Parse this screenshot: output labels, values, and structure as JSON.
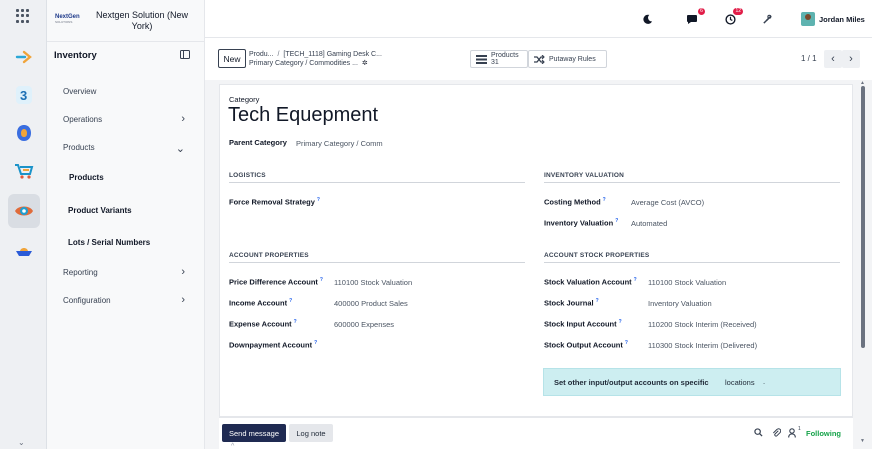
{
  "company": {
    "logo_text": "NextGen",
    "logo_sub": "SOLUTIONS",
    "name": "Nextgen Solution (New York)"
  },
  "apps": [
    {
      "icon": "discuss-app-icon"
    },
    {
      "icon": "3cx-app-icon"
    },
    {
      "icon": "apps-icon"
    },
    {
      "icon": "sales-cart-icon"
    },
    {
      "icon": "inventory-app-icon"
    },
    {
      "icon": "boat-app-icon"
    }
  ],
  "sidebar": {
    "module_title": "Inventory",
    "items": [
      {
        "label": "Overview"
      },
      {
        "label": "Operations"
      },
      {
        "label": "Products"
      },
      {
        "label": "Reporting"
      },
      {
        "label": "Configuration"
      }
    ],
    "sub_items": [
      {
        "label": "Products"
      },
      {
        "label": "Product Variants"
      },
      {
        "label": "Lots / Serial Numbers"
      }
    ]
  },
  "topbar": {
    "messages_badge": "6",
    "activities_badge": "12",
    "user_name": "Jordan Miles"
  },
  "control": {
    "new_label": "New",
    "breadcrumb_1": "Produ...",
    "breadcrumb_2": "[TECH_1118] Gaming Desk C...",
    "breadcrumb_current": "Primary Category / Commodities ...",
    "products_label": "Products",
    "products_count": "31",
    "putaway_label": "Putaway Rules",
    "pager": "1 / 1"
  },
  "form": {
    "category_label": "Category",
    "category_name": "Tech Equepment",
    "parent_label": "Parent Category",
    "parent_value": "Primary Category / Comm",
    "logistics": {
      "title": "LOGISTICS",
      "removal_label": "Force Removal Strategy",
      "removal_value": ""
    },
    "valuation": {
      "title": "INVENTORY VALUATION",
      "costing_label": "Costing Method",
      "costing_value": "Average Cost (AVCO)",
      "inv_val_label": "Inventory Valuation",
      "inv_val_value": "Automated"
    },
    "account_props": {
      "title": "ACCOUNT PROPERTIES",
      "rows": [
        {
          "label": "Price Difference Account",
          "value": "110100 Stock Valuation"
        },
        {
          "label": "Income Account",
          "value": "400000 Product Sales"
        },
        {
          "label": "Expense Account",
          "value": "600000 Expenses"
        },
        {
          "label": "Downpayment Account",
          "value": ""
        }
      ]
    },
    "stock_props": {
      "title": "ACCOUNT STOCK PROPERTIES",
      "rows": [
        {
          "label": "Stock Valuation Account",
          "value": "110100 Stock Valuation"
        },
        {
          "label": "Stock Journal",
          "value": "Inventory Valuation"
        },
        {
          "label": "Stock Input Account",
          "value": "110200 Stock Interim (Received)"
        },
        {
          "label": "Stock Output Account",
          "value": "110300 Stock Interim (Delivered)"
        }
      ]
    },
    "alert": {
      "text": "Set other input/output accounts on specific",
      "link": "locations",
      "suffix": "."
    },
    "help_mark": "?"
  },
  "chatter": {
    "send_label": "Send message",
    "log_label": "Log note",
    "followers_count": "1",
    "following_label": "Following"
  },
  "colors": {
    "accent": "#1f2a52",
    "following": "#16a34a",
    "alert_bg": "#cdeef1",
    "badge": "#e11d48"
  }
}
